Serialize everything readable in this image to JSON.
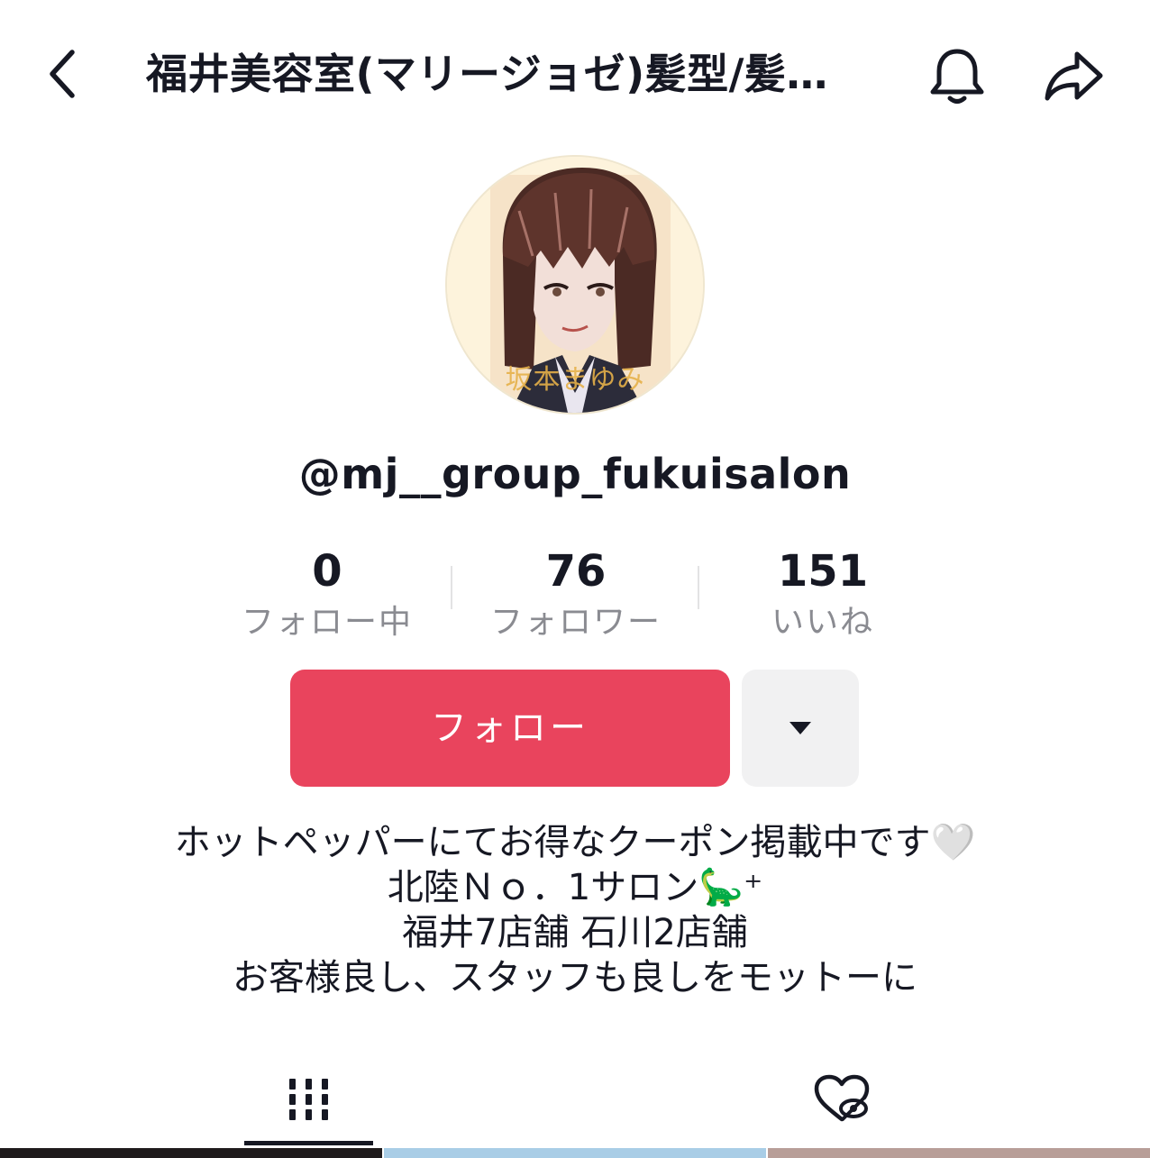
{
  "header": {
    "title": "福井美容室(マリージョゼ)髪型/髪…"
  },
  "profile": {
    "avatar_caption": "坂本まゆみ",
    "username": "@mj__group_fukuisalon"
  },
  "stats": [
    {
      "number": "0",
      "label": "フォロー中"
    },
    {
      "number": "76",
      "label": "フォロワー"
    },
    {
      "number": "151",
      "label": "いいね"
    }
  ],
  "actions": {
    "follow_label": "フォロー"
  },
  "bio": {
    "lines": [
      "ホットペッパーにてお得なクーポン掲載中です🤍",
      "北陸Ｎｏ．1サロン🦕⁺",
      "福井7店舗 石川2店舗",
      "お客様良し、スタッフも良しをモットーに"
    ]
  },
  "tabs": [
    {
      "icon": "grid-icon",
      "active": true
    },
    {
      "icon": "liked-hidden-icon",
      "active": false
    }
  ],
  "colors": {
    "accent": "#e9445d",
    "text": "#161823",
    "muted": "#8a8b91",
    "secondary_button": "#f1f1f2"
  }
}
